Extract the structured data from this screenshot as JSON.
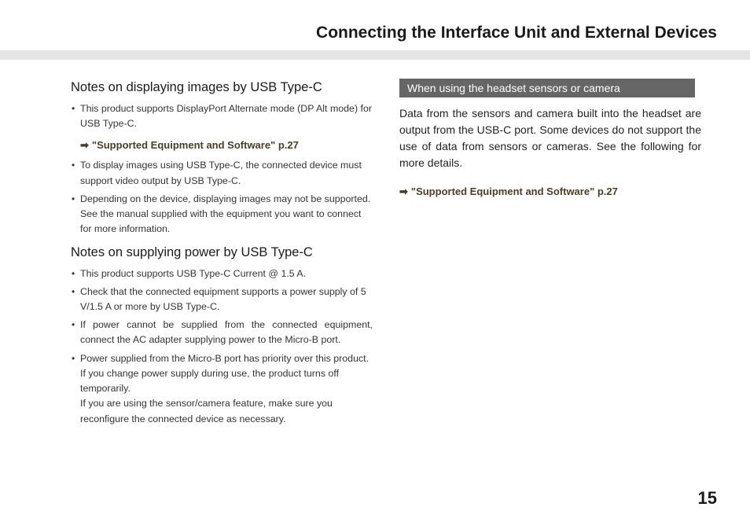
{
  "title": "Connecting the Interface Unit and External Devices",
  "pageNumber": "15",
  "left": {
    "section1": {
      "heading": "Notes on displaying images by USB Type-C",
      "b1": "This product supports DisplayPort Alternate mode (DP Alt mode) for USB Type-C.",
      "crossref": "\"Supported Equipment and Software\" p.27",
      "b2": "To display images using USB Type-C, the connected device must support video output by USB Type-C.",
      "b3": "Depending on the device, displaying images may not be supported. See the manual supplied with the equipment you want to connect for more information."
    },
    "section2": {
      "heading": "Notes on supplying power by USB Type-C",
      "b1": "This product supports USB Type-C Current @ 1.5 A.",
      "b2": "Check that the connected equipment supports a power supply of 5 V/1.5 A or more by USB Type-C.",
      "b3": "If power cannot be supplied from the connected equipment, connect the AC adapter supplying power to the Micro-B port.",
      "b4a": "Power supplied from the Micro-B port has priority over this product. If you change power supply during use, the product turns off temporarily.",
      "b4b": "If you are using the sensor/camera feature, make sure you reconfigure the connected device as necessary."
    }
  },
  "right": {
    "boxHeading": "When using the headset sensors or camera",
    "body": "Data from the sensors and camera built into the headset are output from the USB-C port. Some devices do not support the use of data from sensors or cameras. See the following for more details.",
    "crossref": "\"Supported Equipment and Software\" p.27"
  }
}
